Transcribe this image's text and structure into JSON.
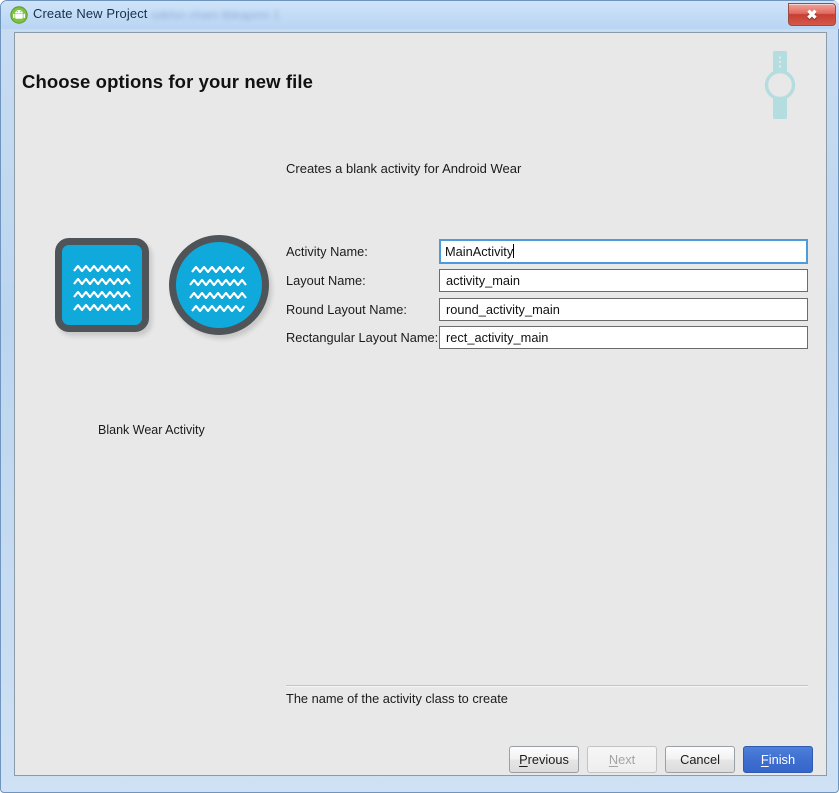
{
  "window": {
    "title": "Create New Project",
    "app_icon": "android-icon",
    "background_ghost_text": "sdkfsn  cham  libkapmn  1",
    "close_label": "✖"
  },
  "header": {
    "page_title": "Choose options for your new file",
    "decoration_icon": "smartwatch-icon"
  },
  "main": {
    "description": "Creates a blank activity for Android Wear",
    "preview": {
      "square_icon": "square-watch-face-preview",
      "round_icon": "round-watch-face-preview",
      "caption": "Blank Wear Activity",
      "accent_color": "#0fa9dc",
      "bezel_color": "#4f5458"
    },
    "fields": [
      {
        "name": "activity-name",
        "label": "Activity Name:",
        "value": "MainActivity",
        "focused": true
      },
      {
        "name": "layout-name",
        "label": "Layout Name:",
        "value": "activity_main",
        "focused": false
      },
      {
        "name": "round-layout-name",
        "label": "Round Layout Name:",
        "value": "round_activity_main",
        "focused": false
      },
      {
        "name": "rectangular-layout-name",
        "label": "Rectangular Layout Name:",
        "value": "rect_activity_main",
        "focused": false
      }
    ],
    "help_text": "The name of the activity class to create"
  },
  "footer": {
    "buttons": [
      {
        "name": "previous",
        "label": "Previous",
        "mnemonic": "P",
        "disabled": false,
        "primary": false
      },
      {
        "name": "next",
        "label": "Next",
        "mnemonic": "N",
        "disabled": true,
        "primary": false
      },
      {
        "name": "cancel",
        "label": "Cancel",
        "mnemonic": "",
        "disabled": false,
        "primary": false
      },
      {
        "name": "finish",
        "label": "Finish",
        "mnemonic": "F",
        "disabled": false,
        "primary": true
      }
    ]
  },
  "colors": {
    "titlebar": "#c2dbf6",
    "dialog_bg": "#e8e8e8",
    "primary_button": "#3f6fd0",
    "focus_border": "#4f9ada",
    "watch_icon": "#b4dde0"
  }
}
